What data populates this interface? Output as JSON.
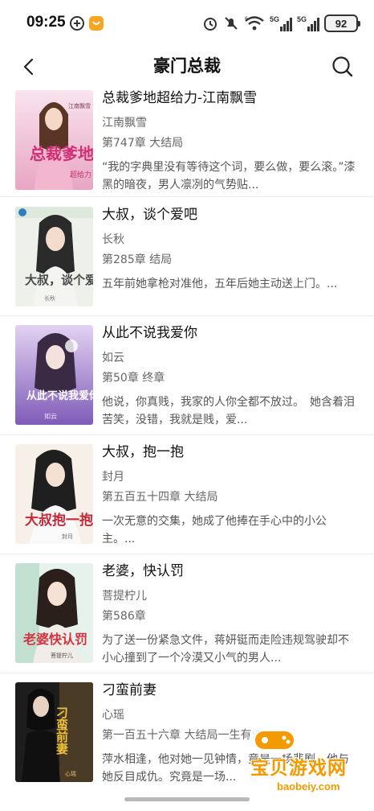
{
  "status_bar": {
    "time": "09:25",
    "battery": "92",
    "network_labels": [
      "5G",
      "5G"
    ],
    "icons": [
      "app-notification-icon",
      "app-badge-icon",
      "alarm-icon",
      "mute-icon",
      "wifi-icon",
      "signal-icon",
      "signal-icon",
      "battery-icon"
    ]
  },
  "nav": {
    "title": "豪门总裁",
    "back_icon": "chevron-left-icon",
    "search_icon": "search-icon"
  },
  "books": [
    {
      "title": "总裁爹地超给力-江南飘雪",
      "author": "江南飘雪",
      "chapter": "第747章  大结局",
      "description": "“我的字典里没有等待这个词，要么做，要么滚。”漆黑的暗夜，男人凛冽的气势贴...",
      "cover_title": "总裁爹地",
      "cover_sub": "超给力",
      "cover_author": "江南飘雪",
      "cover_colors": [
        "#f6d9e6",
        "#e49bb9"
      ]
    },
    {
      "title": "大叔，谈个爱吧",
      "author": "长秋",
      "chapter": "第285章  结局",
      "description": "五年前她拿枪对准他，五年后她主动送上门。...",
      "cover_title": "大叔，谈个爱吧",
      "cover_sub": "",
      "cover_author": "长秋",
      "cover_colors": [
        "#eef0e8",
        "#c9d2c0"
      ]
    },
    {
      "title": "从此不说我爱你",
      "author": "如云",
      "chapter": "第50章  终章",
      "description": "他说，你真贱，我家的人你全都不放过。　她含着泪苦笑，没错，我就是贱，爱...",
      "cover_title": "从此不说我爱你",
      "cover_sub": "",
      "cover_author": "如云",
      "cover_colors": [
        "#d8c4ec",
        "#8f6fc4"
      ]
    },
    {
      "title": "大叔，抱一抱",
      "author": "封月",
      "chapter": "第五百五十四章  大结局",
      "description": "一次无意的交集，她成了他捧在手心中的小公主。...",
      "cover_title": "大叔抱一抱",
      "cover_sub": "",
      "cover_author": "封月",
      "cover_colors": [
        "#f5efe6",
        "#d9c8b4"
      ]
    },
    {
      "title": "老婆，快认罚",
      "author": "菩提柠儿",
      "chapter": "第586章",
      "description": "为了送一份紧急文件，蒋妍铤而走险违规驾驶却不小心撞到了一个冷漠又小气的男人...",
      "cover_title": "老婆快认罚",
      "cover_sub": "",
      "cover_author": "菩提柠儿",
      "cover_colors": [
        "#e6f0ea",
        "#9cc9b4"
      ]
    },
    {
      "title": "刁蛮前妻",
      "author": "心瑶",
      "chapter": "第一百五十六章  大结局一生有你",
      "description": "萍水相逢，他对她一见钟情，竟是一场悲剧，他与她反目成仇。究竟是一场...",
      "cover_title": "刁蛮前妻",
      "cover_sub": "",
      "cover_author": "心瑶",
      "cover_colors": [
        "#2a2a2a",
        "#6b5a3a"
      ]
    }
  ],
  "watermark": {
    "text": "宝贝游戏网",
    "url": "baobeiy.com"
  }
}
